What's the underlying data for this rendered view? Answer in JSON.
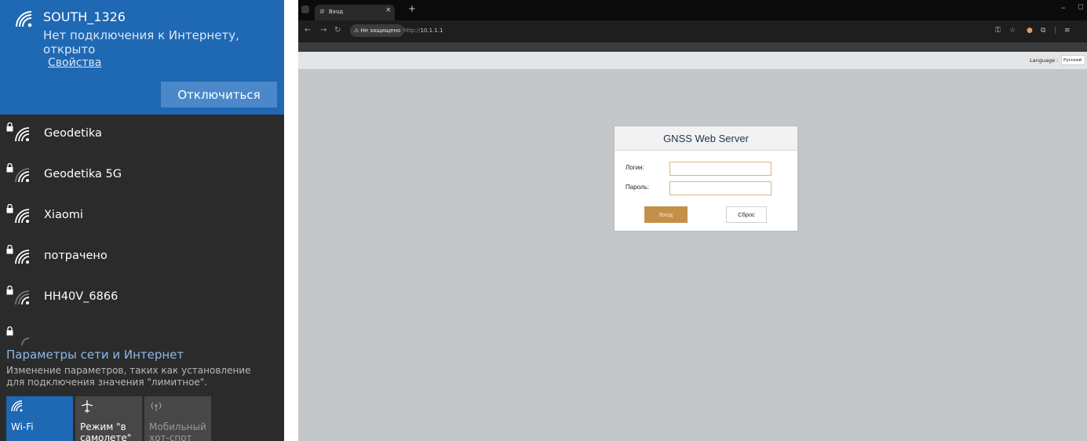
{
  "wifi": {
    "connected": {
      "name": "SOUTH_1326",
      "status": "Нет подключения к Интернету, открыто",
      "properties_link": "Свойства",
      "disconnect_label": "Отключиться"
    },
    "networks": [
      {
        "name": "Geodetika"
      },
      {
        "name": "Geodetika 5G"
      },
      {
        "name": "Xiaomi"
      },
      {
        "name": "потрачено"
      },
      {
        "name": "HH40V_6866"
      },
      {
        "name": ""
      }
    ],
    "settings": {
      "title": "Параметры сети и Интернет",
      "description": "Изменение параметров, таких как установление для подключения значения \"лимитное\"."
    },
    "tiles": [
      {
        "label": "Wi-Fi",
        "icon": "wifi-icon",
        "active": true
      },
      {
        "label": "Режим \"в самолете\"",
        "icon": "airplane-icon",
        "active": false
      },
      {
        "label": "Мобильный хот-спот",
        "icon": "hotspot-icon",
        "active": false
      }
    ],
    "colors": {
      "accent": "#1f68b4",
      "panel": "#2b2b2b",
      "tile_active": "#1f68b4",
      "tile_inactive": "#474747"
    }
  },
  "browser": {
    "tab_title": "Вход",
    "security_label": "Не защищено",
    "url_protocol": "http://",
    "url_host": "10.1.1.1",
    "language_label": "Language :",
    "language_value": "Русский",
    "login": {
      "title": "GNSS Web Server",
      "username_label": "Логин:",
      "password_label": "Пароль:",
      "username_value": "",
      "password_value": "",
      "login_button": "Вход",
      "reset_button": "Сброс"
    },
    "colors": {
      "page_bg": "#c4c7ca",
      "login_button": "#c38f49",
      "title": "#1d3557"
    }
  }
}
